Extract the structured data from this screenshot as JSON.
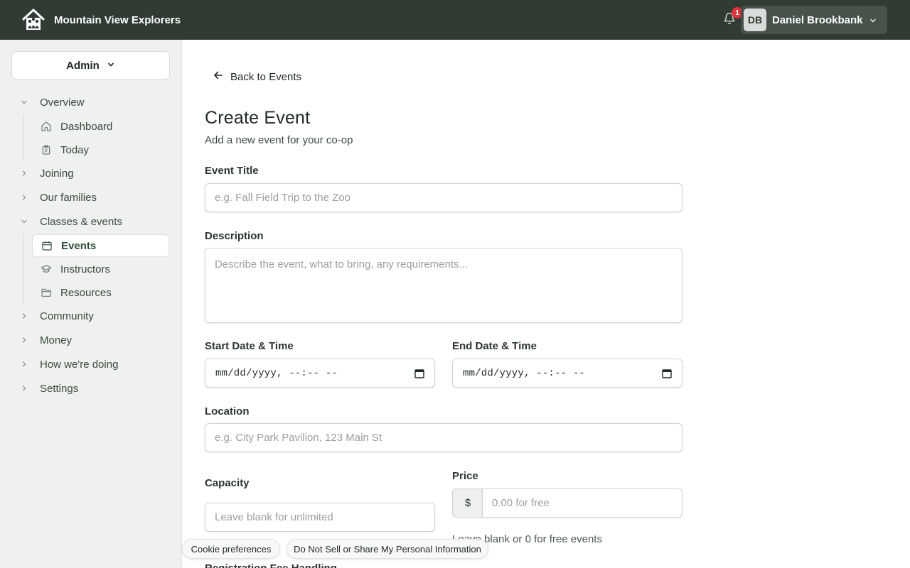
{
  "app": {
    "name": "Mountain View Explorers",
    "notifications_count": "1",
    "user": {
      "initials": "DB",
      "name": "Daniel Brookbank"
    }
  },
  "sidebar": {
    "role": "Admin",
    "groups": [
      {
        "label": "Overview",
        "expanded": true
      },
      {
        "label": "Joining",
        "expanded": false
      },
      {
        "label": "Our families",
        "expanded": false
      },
      {
        "label": "Classes & events",
        "expanded": true
      },
      {
        "label": "Community",
        "expanded": false
      },
      {
        "label": "Money",
        "expanded": false
      },
      {
        "label": "How we're doing",
        "expanded": false
      },
      {
        "label": "Settings",
        "expanded": false
      }
    ],
    "overview_items": [
      {
        "label": "Dashboard",
        "icon": "home-icon"
      },
      {
        "label": "Today",
        "icon": "clipboard-icon"
      }
    ],
    "classes_items": [
      {
        "label": "Events",
        "icon": "calendar-icon",
        "active": true
      },
      {
        "label": "Instructors",
        "icon": "graduation-cap-icon"
      },
      {
        "label": "Resources",
        "icon": "folder-icon"
      }
    ]
  },
  "main": {
    "back_label": "Back to Events",
    "title": "Create Event",
    "subtitle": "Add a new event for your co-op",
    "form": {
      "title_label": "Event Title",
      "title_placeholder": "e.g. Fall Field Trip to the Zoo",
      "title_value": "",
      "description_label": "Description",
      "description_placeholder": "Describe the event, what to bring, any requirements...",
      "description_value": "",
      "start_label": "Start Date & Time",
      "start_value": "mm/dd/yyyy, --:-- --",
      "end_label": "End Date & Time",
      "end_value": "mm/dd/yyyy, --:-- --",
      "location_label": "Location",
      "location_placeholder": "e.g. City Park Pavilion, 123 Main St",
      "location_value": "",
      "capacity_label": "Capacity",
      "capacity_placeholder": "Leave blank for unlimited",
      "capacity_value": "",
      "price_label": "Price",
      "price_prefix": "$",
      "price_placeholder": "0.00 for free",
      "price_value": "",
      "price_help": "Leave blank or 0 for free events",
      "next_label_partial": "Registration Fee Handling"
    }
  },
  "cookie_bar": {
    "preferences_label": "Cookie preferences",
    "do_not_sell_label": "Do Not Sell or Share My Personal Information"
  },
  "colors": {
    "topbar": "#2f3b33",
    "sidebar_bg": "#eef1ee",
    "accent": "#2e4a37",
    "badge": "#e0313c"
  }
}
